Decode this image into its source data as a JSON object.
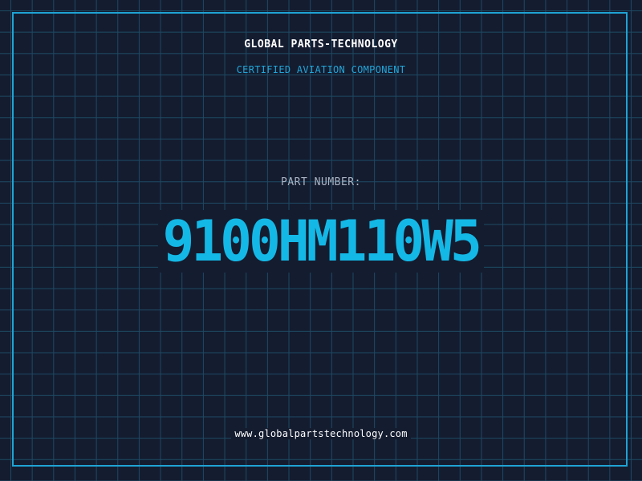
{
  "header": {
    "brand": "GLOBAL PARTS-TECHNOLOGY",
    "subtitle": "CERTIFIED AVIATION COMPONENT"
  },
  "part": {
    "label": "PART NUMBER:",
    "number": "9100HM110W5"
  },
  "footer": {
    "url": "www.globalpartstechnology.com"
  },
  "colors": {
    "background": "#141c30",
    "grid": "#1d4a63",
    "accent": "#14b8e6",
    "frame": "#1fa3d4",
    "text": "#ffffff"
  }
}
